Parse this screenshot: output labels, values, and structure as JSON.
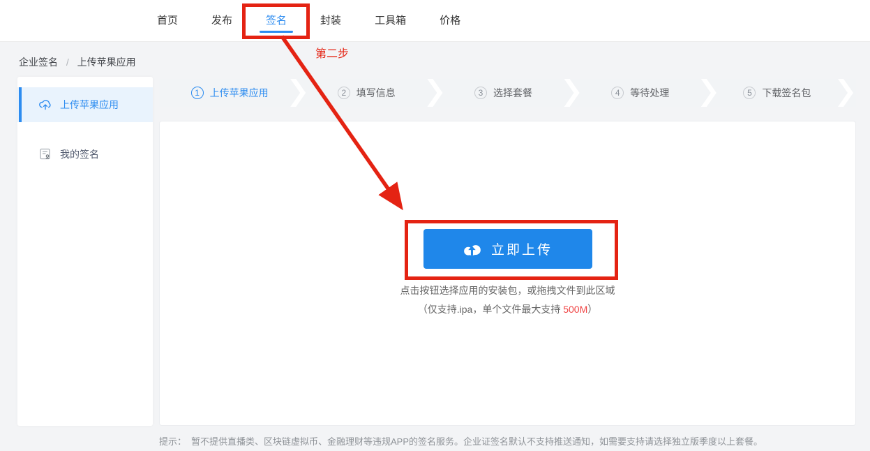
{
  "nav": {
    "items": [
      {
        "label": "首页",
        "active": false
      },
      {
        "label": "发布",
        "active": false
      },
      {
        "label": "签名",
        "active": true
      },
      {
        "label": "封装",
        "active": false
      },
      {
        "label": "工具箱",
        "active": false
      },
      {
        "label": "价格",
        "active": false
      }
    ]
  },
  "breadcrumb": {
    "parts": [
      "企业签名",
      "上传苹果应用"
    ],
    "separator": "/"
  },
  "sidebar": {
    "items": [
      {
        "label": "上传苹果应用",
        "icon": "cloud-upload-icon",
        "active": true
      },
      {
        "label": "我的签名",
        "icon": "signature-doc-icon",
        "active": false
      }
    ]
  },
  "steps": [
    {
      "num": "1",
      "label": "上传苹果应用",
      "active": true
    },
    {
      "num": "2",
      "label": "填写信息",
      "active": false
    },
    {
      "num": "3",
      "label": "选择套餐",
      "active": false
    },
    {
      "num": "4",
      "label": "等待处理",
      "active": false
    },
    {
      "num": "5",
      "label": "下载签名包",
      "active": false
    }
  ],
  "upload": {
    "button_label": "立即上传",
    "button_icon": "cloud-upload-icon",
    "hint_line1": "点击按钮选择应用的安装包，或拖拽文件到此区域",
    "hint2_prefix": "（仅支持.ipa，单个文件最大支持 ",
    "hint2_highlight": "500M",
    "hint2_suffix": "）"
  },
  "footer": {
    "tip_label": "提示：",
    "tip_text": "暂不提供直播类、区块链虚拟币、金融理财等违规APP的签名服务。企业证签名默认不支持推送通知，如需要支持请选择独立版季度以上套餐。"
  },
  "annotations": {
    "step_label": "第二步"
  },
  "colors": {
    "accent_blue": "#2d8cf0",
    "button_blue": "#1f87ea",
    "annotation_red": "#e42313",
    "highlight_red": "#f04545",
    "selected_bg": "#e9f3fd",
    "page_bg": "#f3f4f6",
    "step_segment_bg": "#f2f4f6"
  }
}
